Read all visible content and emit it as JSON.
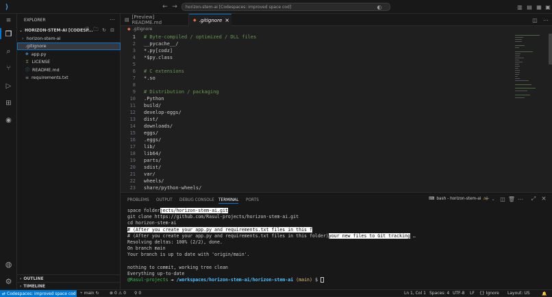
{
  "titlebar": {
    "command_center": "horizon-stem-ai [Codespaces: improved space cod]"
  },
  "colors": {
    "accent": "#0078d4",
    "git_branch": "#3fb950",
    "prompt_user": "#3fb950",
    "path": "#4fc1ff",
    "branch": "#e5c07b"
  },
  "sidebar": {
    "header": "EXPLORER",
    "repo": "HORIZON-STEM-AI [CODESP...",
    "items": [
      {
        "label": "horizon-stem-ai",
        "icon": "chevron-right-icon",
        "color": "#cccccc"
      },
      {
        "label": ".gitignore",
        "icon": "",
        "color": "#cccccc"
      },
      {
        "label": "app.py",
        "icon": "python-icon",
        "color": "#cccccc"
      },
      {
        "label": "LICENSE",
        "icon": "license-icon",
        "color": "#cccccc"
      },
      {
        "label": "README.md",
        "icon": "info-icon",
        "color": "#cccccc"
      },
      {
        "label": "requirements.txt",
        "icon": "list-icon",
        "color": "#cccccc"
      }
    ],
    "outline": "OUTLINE",
    "timeline": "TIMELINE"
  },
  "tabs": [
    {
      "label": "[Preview] README.md"
    },
    {
      "label": ".gitignore"
    }
  ],
  "breadcrumb": ".gitignore",
  "editor_lines": [
    {
      "n": "1",
      "text": "# Byte-compiled / optimized / DLL files",
      "comment": true
    },
    {
      "n": "2",
      "text": "__pycache__/",
      "comment": false
    },
    {
      "n": "3",
      "text": "*.py[codz]",
      "comment": false
    },
    {
      "n": "4",
      "text": "*$py.class",
      "comment": false
    },
    {
      "n": "5",
      "text": "",
      "comment": false
    },
    {
      "n": "6",
      "text": "# C extensions",
      "comment": true
    },
    {
      "n": "7",
      "text": "*.so",
      "comment": false
    },
    {
      "n": "8",
      "text": "",
      "comment": false
    },
    {
      "n": "9",
      "text": "# Distribution / packaging",
      "comment": true
    },
    {
      "n": "10",
      "text": ".Python",
      "comment": false
    },
    {
      "n": "11",
      "text": "build/",
      "comment": false
    },
    {
      "n": "12",
      "text": "develop-eggs/",
      "comment": false
    },
    {
      "n": "13",
      "text": "dist/",
      "comment": false
    },
    {
      "n": "14",
      "text": "downloads/",
      "comment": false
    },
    {
      "n": "15",
      "text": "eggs/",
      "comment": false
    },
    {
      "n": "16",
      "text": ".eggs/",
      "comment": false
    },
    {
      "n": "17",
      "text": "lib/",
      "comment": false
    },
    {
      "n": "18",
      "text": "lib64/",
      "comment": false
    },
    {
      "n": "19",
      "text": "parts/",
      "comment": false
    },
    {
      "n": "20",
      "text": "sdist/",
      "comment": false
    },
    {
      "n": "21",
      "text": "var/",
      "comment": false
    },
    {
      "n": "22",
      "text": "wheels/",
      "comment": false
    },
    {
      "n": "23",
      "text": "share/python-wheels/",
      "comment": false
    }
  ],
  "panel": {
    "tabs": [
      "PROBLEMS",
      "OUTPUT",
      "DEBUG CONSOLE",
      "TERMINAL",
      "PORTS"
    ],
    "terminal_name": "bash - horizon-stem-ai",
    "terminal": {
      "l1a": "space folder",
      "l1b": "jects/horizon-stem-ai.git",
      "l2": "git clone https://github.com/Rasul-projects/horizon-stem-ai.git",
      "l3": "cd horizon-stem-ai",
      "l4": "# (After you create your app.py and requirements.txt files in this f",
      "l5a": "# (After you create your app.py and requirements.txt files in this folder)",
      "l5b": "your new files to Git tracking",
      "l5c": " …",
      "l6": "Resolving deltas: 100% (2/2), done.",
      "l7": "On branch main",
      "l8": "Your branch is up to date with 'origin/main'.",
      "l9": "",
      "l10": "nothing to commit, working tree clean",
      "l11": "Everything up-to-date",
      "prompt_user": "@Rasul-projects",
      "prompt_arrow": " →",
      "prompt_path": "/workspaces/horizon-stem-ai/horizon-stem-ai",
      "prompt_branch": "(main)",
      "prompt_sym": " $ "
    }
  },
  "status": {
    "remote": "Codespaces: improved space cod",
    "branch": "main",
    "errors": "0",
    "warnings": "0",
    "ports": "0",
    "position": "Ln 1, Col 1",
    "spaces": "Spaces: 4",
    "encoding": "UTF-8",
    "eol": "LF",
    "language": "Ignore",
    "layout": "Layout: US"
  }
}
